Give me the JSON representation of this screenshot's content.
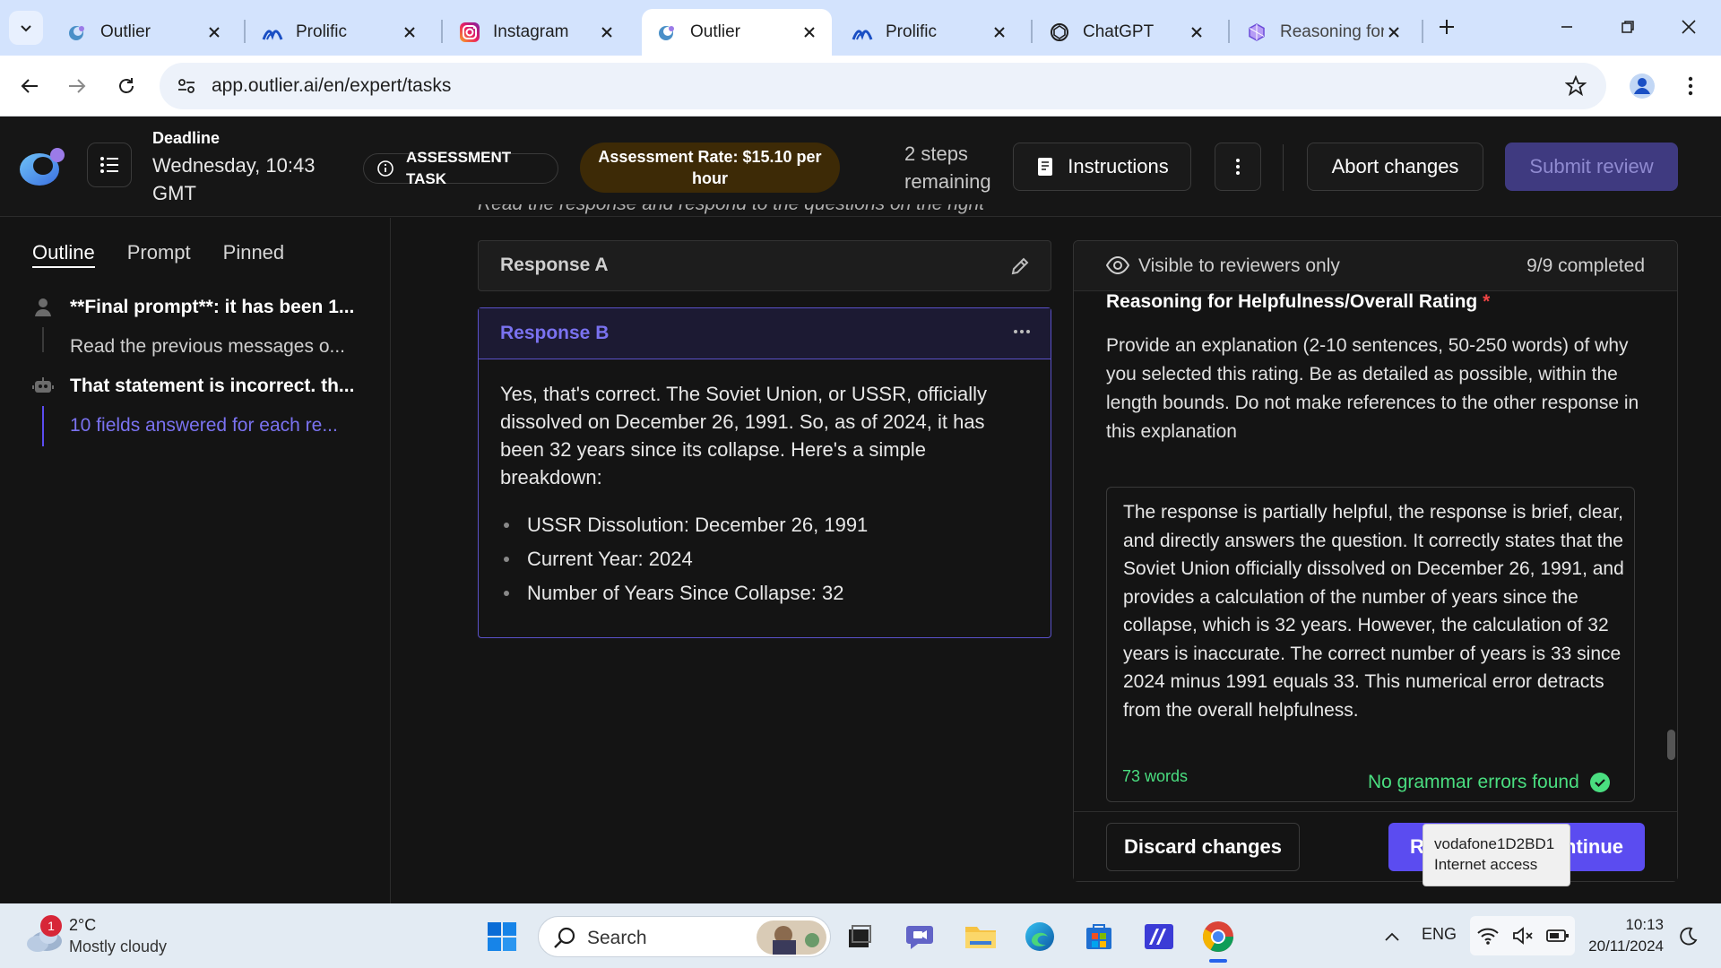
{
  "browser": {
    "tabs": [
      {
        "title": "Outlier",
        "icon": "outlier-icon",
        "active": false
      },
      {
        "title": "Prolific",
        "icon": "prolific-icon",
        "active": false
      },
      {
        "title": "Instagram",
        "icon": "instagram-icon",
        "active": false
      },
      {
        "title": "Outlier",
        "icon": "outlier-icon",
        "active": true
      },
      {
        "title": "Prolific",
        "icon": "prolific-icon",
        "active": false
      },
      {
        "title": "ChatGPT",
        "icon": "chatgpt-icon",
        "active": false
      },
      {
        "title": "Reasoning for",
        "icon": "reasoning-icon",
        "active": false
      }
    ],
    "url": "app.outlier.ai/en/expert/tasks"
  },
  "header": {
    "deadline_label": "Deadline",
    "deadline_value": "Wednesday, 10:43 GMT",
    "assessment_badge": "ASSESSMENT TASK",
    "rate": "Assessment Rate: $15.10 per hour",
    "steps": "2 steps remaining",
    "instructions_label": "Instructions",
    "abort_label": "Abort changes",
    "submit_label": "Submit review"
  },
  "sidebar": {
    "tabs": [
      "Outline",
      "Prompt",
      "Pinned"
    ],
    "active_tab": "Outline",
    "items": [
      {
        "text": "**Final prompt**: it has been 1...",
        "bold": true,
        "icon": "user-icon"
      },
      {
        "text": "Read the previous messages o...",
        "bold": false
      },
      {
        "text": "That statement is incorrect. th...",
        "bold": true,
        "icon": "bot-icon"
      },
      {
        "text": "10 fields answered for each re...",
        "bold": false,
        "accent": true
      }
    ]
  },
  "middle": {
    "instruction": "Read the response and respond to the questions on the right",
    "response_a_title": "Response A",
    "response_b_title": "Response B",
    "response_b_text": "Yes, that's correct. The Soviet Union, or USSR, officially dissolved on December 26, 1991. So, as of 2024, it has been 32 years since its collapse. Here's a simple breakdown:",
    "response_b_bullets": [
      "USSR Dissolution: December 26, 1991",
      "Current Year: 2024",
      "Number of Years Since Collapse: 32"
    ]
  },
  "panel": {
    "visibility": "Visible to reviewers only",
    "completed": "9/9 completed",
    "question_title": "Reasoning for Helpfulness/Overall Rating",
    "required_mark": "*",
    "question_desc": "Provide an explanation (2-10 sentences, 50-250 words) of why you selected this rating. Be as detailed as possible, within the length bounds. Do not make references to the other response in this explanation",
    "answer_text": "The response is partially helpful, the response is brief, clear, and directly answers the question. It correctly states that the Soviet Union officially dissolved on December 26, 1991, and provides a calculation of the number of years since the collapse, which is 32 years. However, the calculation of 32 years is inaccurate. The correct number of years is 33 since 2024 minus 1991 equals 33. This numerical error detracts from the overall helpfulness.",
    "word_count": "73 words",
    "grammar": "No grammar errors found",
    "discard_label": "Discard changes",
    "continue_left": "R",
    "continue_right": "ntinue"
  },
  "wifi_tooltip": {
    "network": "vodafone1D2BD1",
    "status": "Internet access"
  },
  "taskbar": {
    "weather_badge": "1",
    "temperature": "2°C",
    "condition": "Mostly cloudy",
    "search_placeholder": "Search",
    "language": "ENG",
    "time": "10:13",
    "date": "20/11/2024"
  },
  "colors": {
    "accent": "#5b4cf0",
    "success": "#4ade80",
    "rate_pill": "#3d2a06"
  }
}
